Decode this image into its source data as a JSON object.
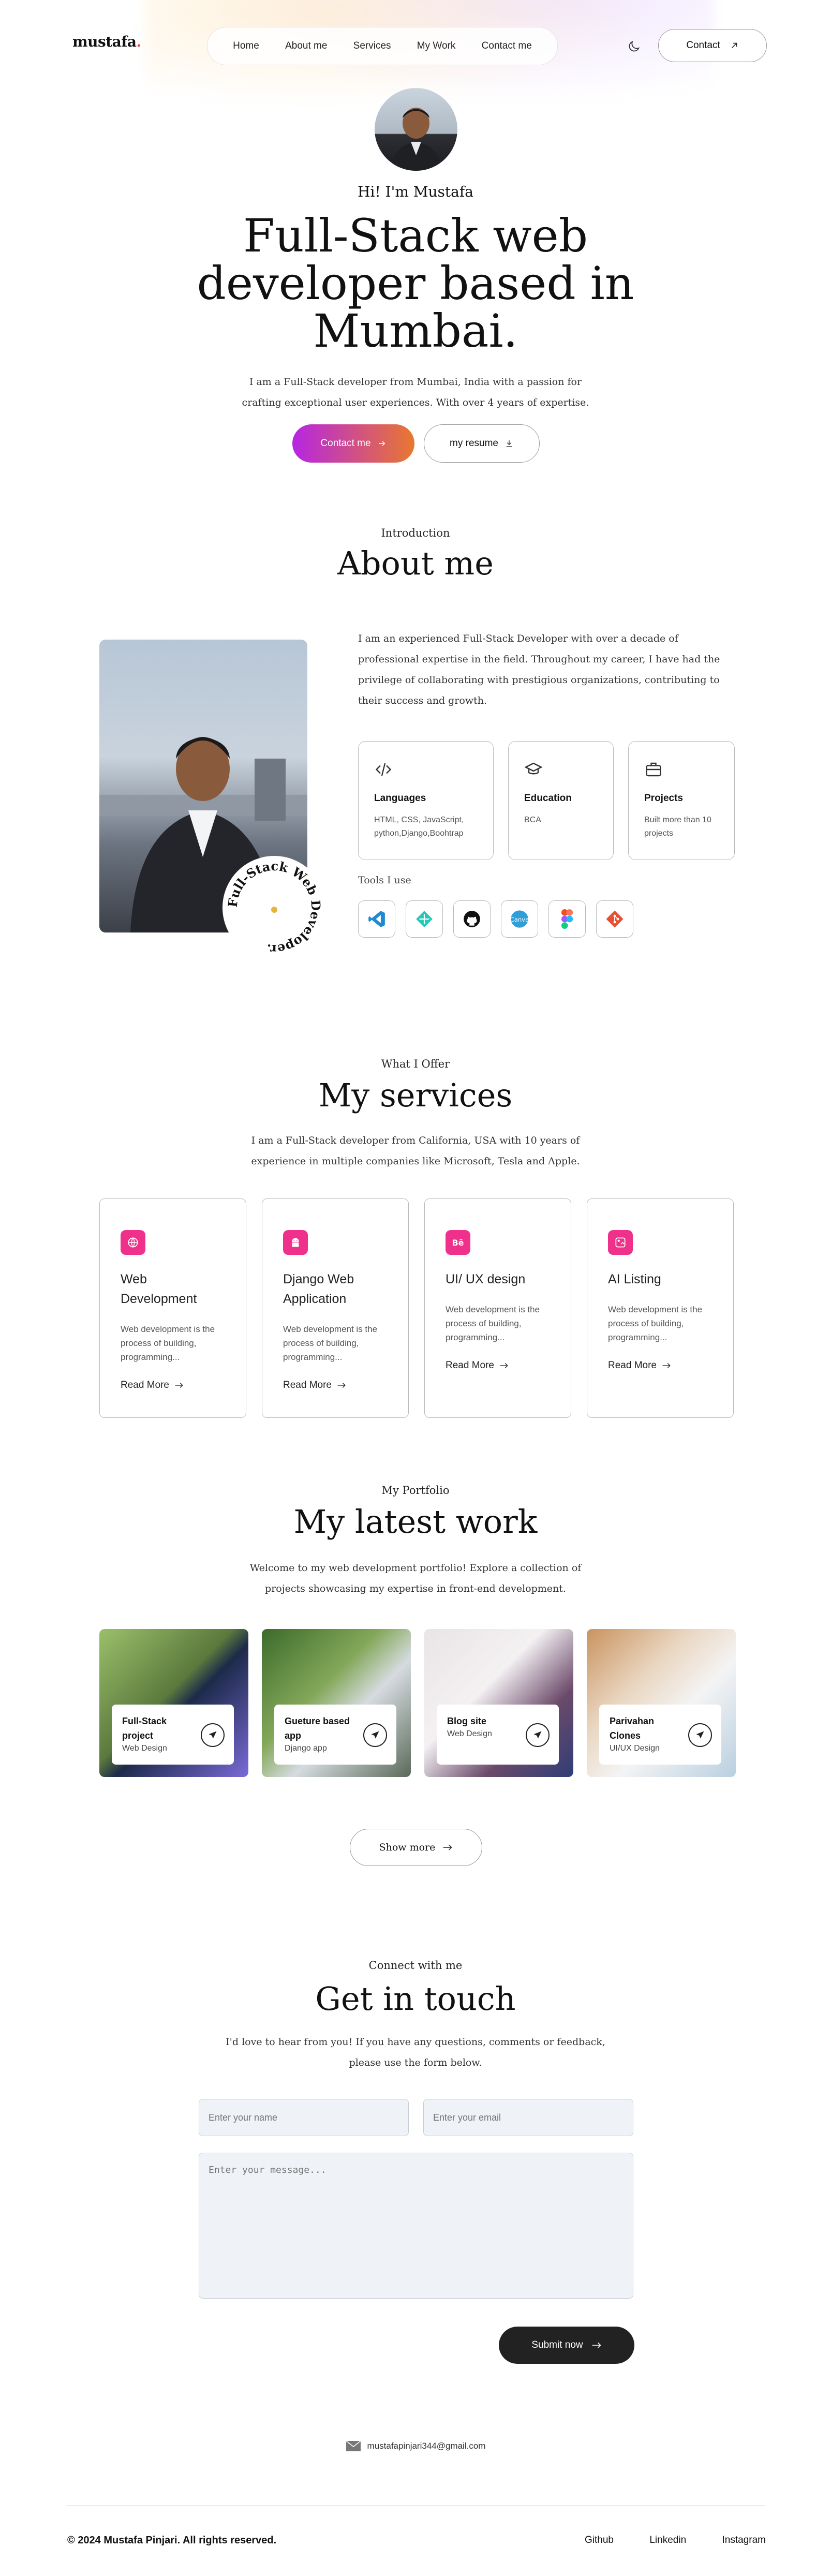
{
  "header": {
    "logo": "mustafa",
    "logo_dot": ".",
    "nav": [
      "Home",
      "About me",
      "Services",
      "My Work",
      "Contact me"
    ],
    "contact_label": "Contact"
  },
  "hero": {
    "greeting": "Hi! I'm Mustafa",
    "title": "Full-Stack web developer based in Mumbai.",
    "subtitle": "I am a Full-Stack developer from Mumbai, India with a passion for crafting exceptional user experiences. With over 4 years of expertise.",
    "primary_label": "Contact me",
    "secondary_label": "my resume"
  },
  "about": {
    "kicker": "Introduction",
    "title": "About me",
    "paragraph": "I am an experienced Full-Stack Developer with over a decade of professional expertise in the field. Throughout my career, I have had the privilege of collaborating with prestigious organizations, contributing to their success and growth.",
    "badge_text": "Full-Stack Web Developer.",
    "cards": [
      {
        "title": "Languages",
        "desc": "HTML, CSS, JavaScript, python,Django,Boohtrap"
      },
      {
        "title": "Education",
        "desc": "BCA"
      },
      {
        "title": "Projects",
        "desc": "Built more than 10 projects"
      }
    ],
    "tools_label": "Tools I use",
    "tools": [
      "vscode-icon",
      "netlify-icon",
      "github-icon",
      "canva-icon",
      "figma-icon",
      "git-icon"
    ]
  },
  "services": {
    "kicker": "What I Offer",
    "title": "My services",
    "desc": "I am a Full-Stack developer from California, USA with 10 years of experience in multiple companies like Microsoft, Tesla and Apple.",
    "items": [
      {
        "title": "Web Development",
        "desc": "Web development is the process of building, programming...",
        "more": "Read More"
      },
      {
        "title": "Django Web Application",
        "desc": "Web development is the process of building, programming...",
        "more": "Read More"
      },
      {
        "title": "UI/ UX design",
        "desc": "Web development is the process of building, programming...",
        "more": "Read More"
      },
      {
        "title": "AI Listing",
        "desc": "Web development is the process of building, programming...",
        "more": "Read More"
      }
    ]
  },
  "work": {
    "kicker": "My Portfolio",
    "title": "My latest work",
    "desc": "Welcome to my web development portfolio! Explore a collection of projects showcasing my expertise in front-end development.",
    "items": [
      {
        "title": "Full-Stack project",
        "sub": "Web Design"
      },
      {
        "title": "Gueture based app",
        "sub": "Django app"
      },
      {
        "title": "Blog site",
        "sub": "Web Design"
      },
      {
        "title": "Parivahan Clones",
        "sub": "UI/UX Design"
      }
    ],
    "show_more": "Show more"
  },
  "contact": {
    "kicker": "Connect with me",
    "title": "Get in touch",
    "desc": "I'd love to hear from you! If you have any questions, comments or feedback, please use the form below.",
    "name_placeholder": "Enter your name",
    "email_placeholder": "Enter your email",
    "message_placeholder": "Enter your message...",
    "submit_label": "Submit now",
    "email": "mustafapinjari344@gmail.com"
  },
  "footer": {
    "copyright": "© 2024 Mustafa Pinjari. All rights reserved.",
    "links": [
      "Github",
      "Linkedin",
      "Instagram"
    ]
  },
  "colors": {
    "gradient_start": "#b626e2",
    "gradient_end": "#e8782f",
    "service_icon": "#f0318b",
    "submit_bg": "#222222"
  }
}
